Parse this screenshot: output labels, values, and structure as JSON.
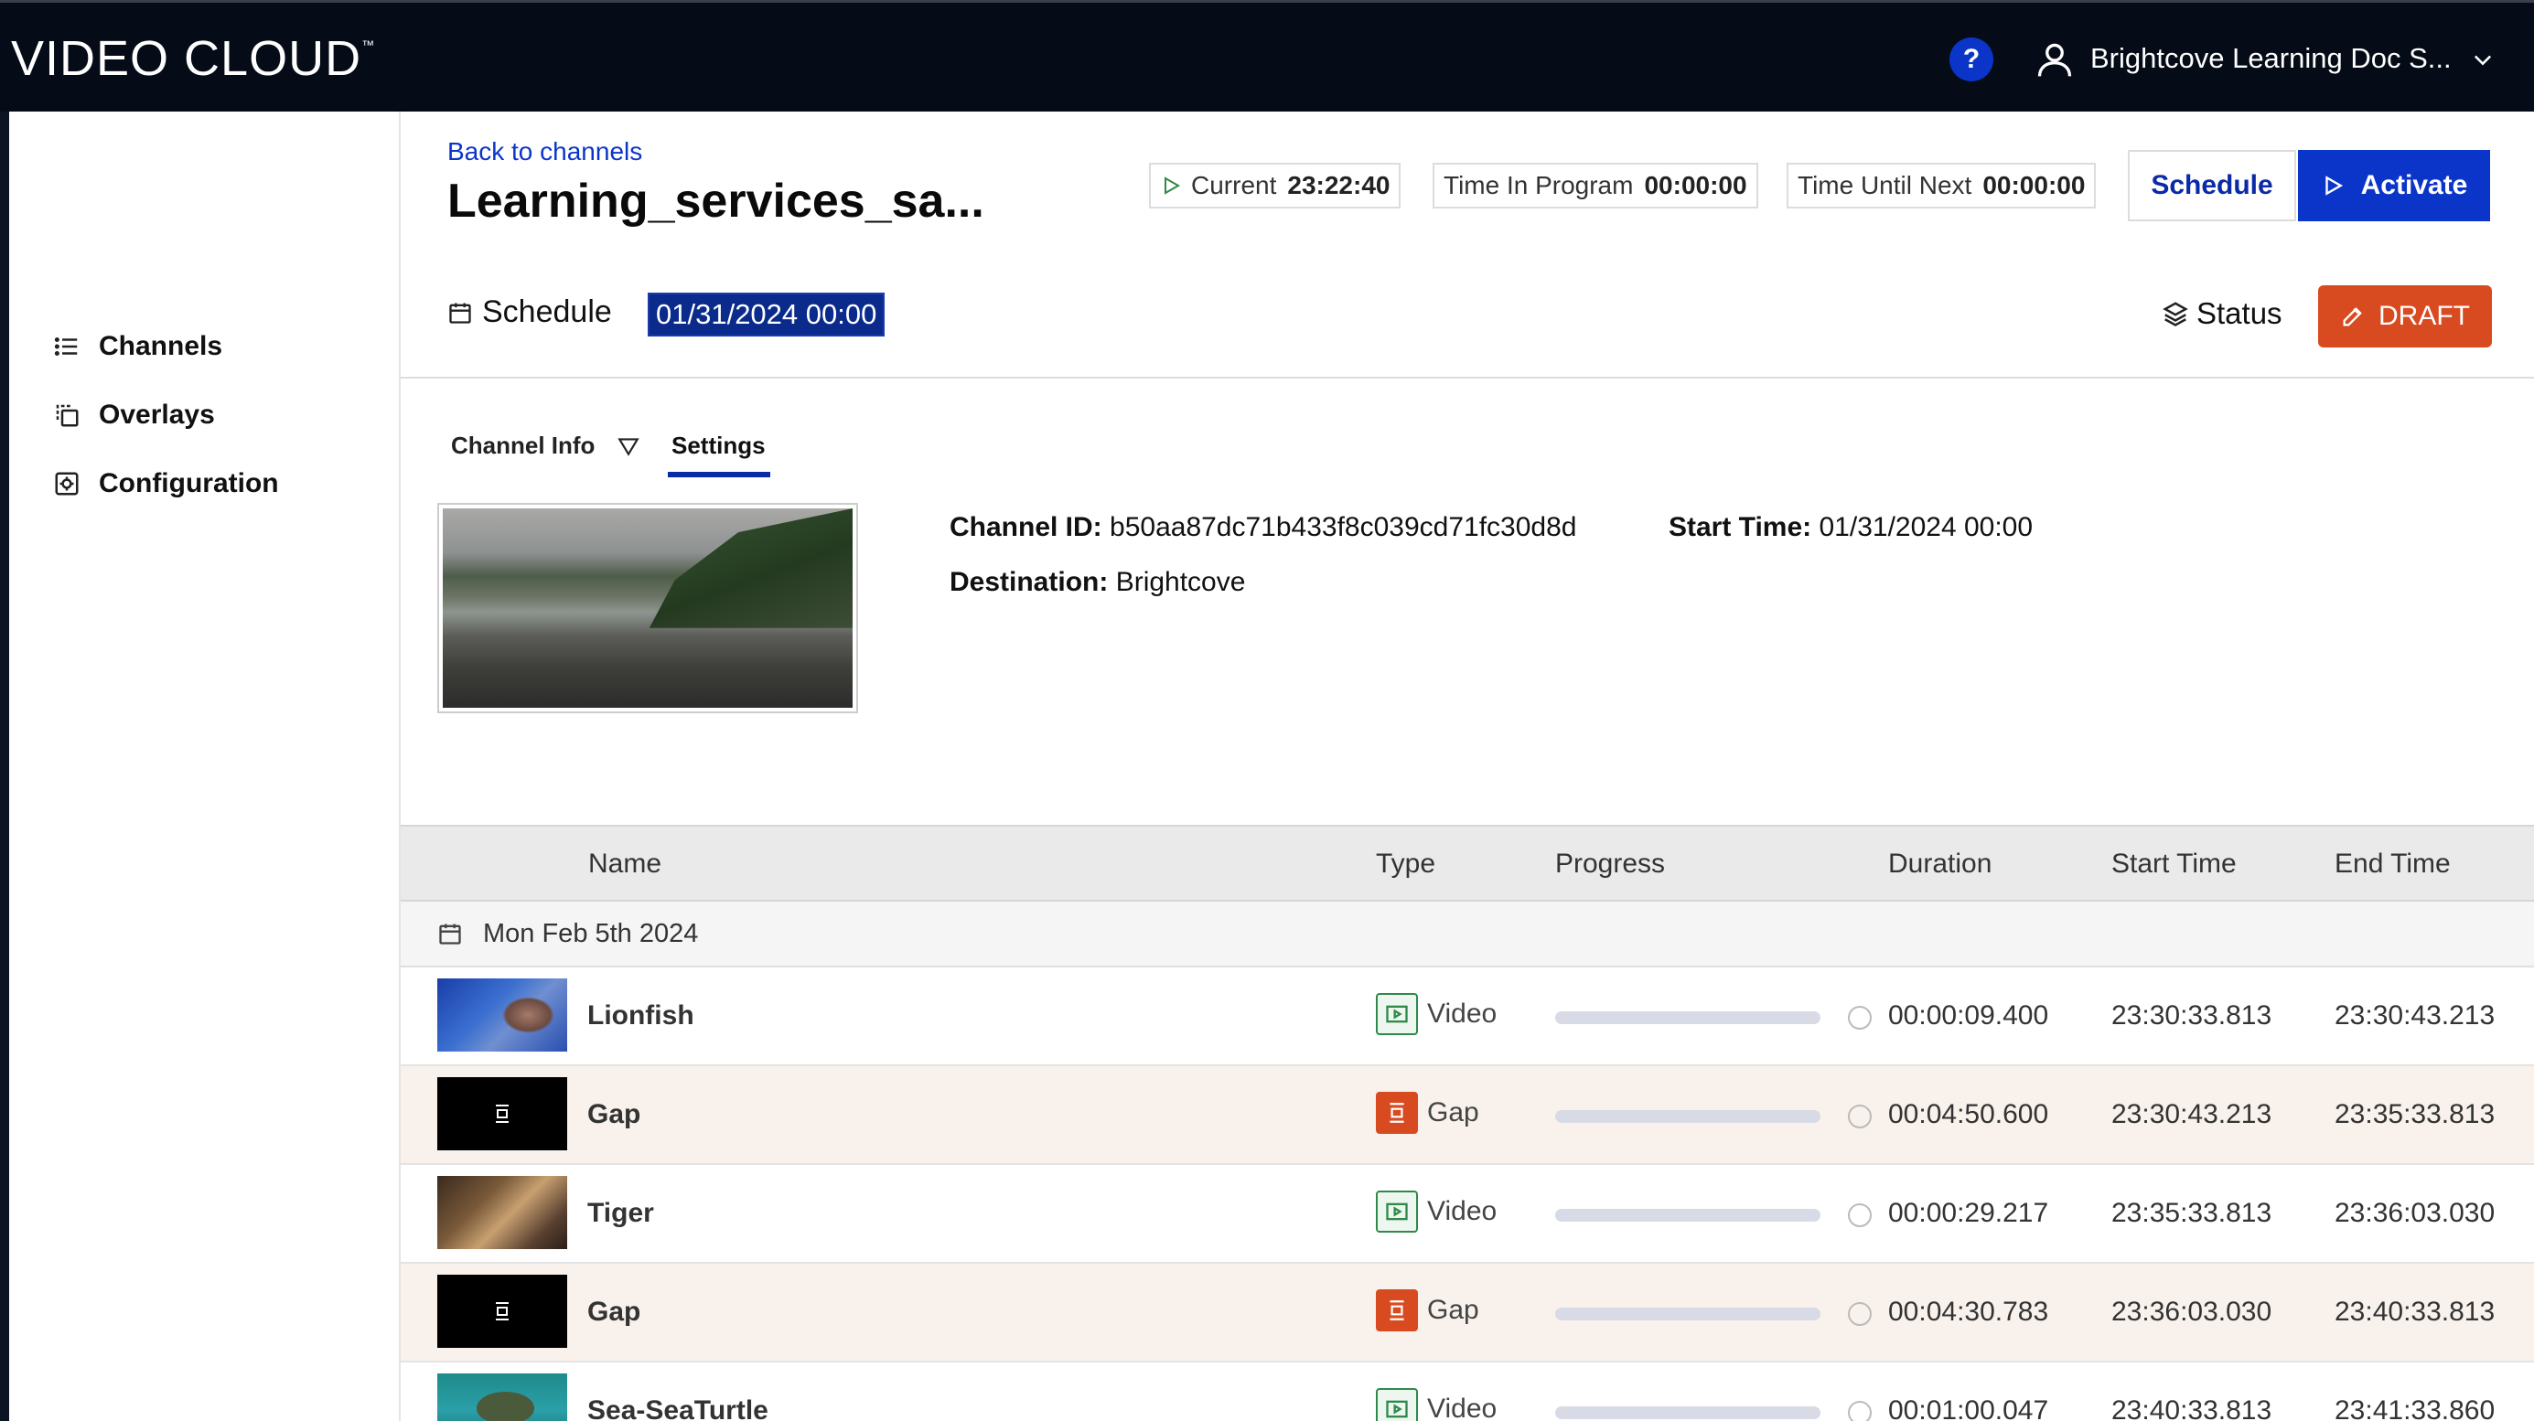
{
  "app": {
    "logo": "VIDEO CLOUD",
    "logo_tm": "™"
  },
  "header": {
    "help_label": "?",
    "account_name": "Brightcove Learning Doc S..."
  },
  "sidebar": {
    "items": [
      {
        "label": "Channels",
        "icon": "list-icon"
      },
      {
        "label": "Overlays",
        "icon": "overlays-icon"
      },
      {
        "label": "Configuration",
        "icon": "configuration-icon"
      }
    ]
  },
  "channel": {
    "back_link": "Back to channels",
    "title": "Learning_services_sa...",
    "current_label": "Current",
    "current_value": "23:22:40",
    "time_in_program_label": "Time In Program",
    "time_in_program_value": "00:00:00",
    "time_until_next_label": "Time Until Next",
    "time_until_next_value": "00:00:00",
    "schedule_button": "Schedule",
    "activate_button": "Activate",
    "schedule_label": "Schedule",
    "schedule_date": "01/31/2024 00:00",
    "status_label": "Status",
    "status_value": "DRAFT"
  },
  "tabs": {
    "channel_info": "Channel Info",
    "settings": "Settings"
  },
  "details": {
    "channel_id_label": "Channel ID:",
    "channel_id_value": "b50aa87dc71b433f8c039cd71fc30d8d",
    "start_time_label": "Start Time:",
    "start_time_value": "01/31/2024 00:00",
    "destination_label": "Destination:",
    "destination_value": "Brightcove"
  },
  "table": {
    "columns": {
      "name": "Name",
      "type": "Type",
      "progress": "Progress",
      "duration": "Duration",
      "start": "Start Time",
      "end": "End Time"
    },
    "group_date": "Mon Feb 5th 2024",
    "rows": [
      {
        "name": "Lionfish",
        "type": "Video",
        "progress": 0,
        "duration": "00:00:09.400",
        "start": "23:30:33.813",
        "end": "23:30:43.213"
      },
      {
        "name": "Gap",
        "type": "Gap",
        "progress": 0,
        "duration": "00:04:50.600",
        "start": "23:30:43.213",
        "end": "23:35:33.813"
      },
      {
        "name": "Tiger",
        "type": "Video",
        "progress": 0,
        "duration": "00:00:29.217",
        "start": "23:35:33.813",
        "end": "23:36:03.030"
      },
      {
        "name": "Gap",
        "type": "Gap",
        "progress": 0,
        "duration": "00:04:30.783",
        "start": "23:36:03.030",
        "end": "23:40:33.813"
      },
      {
        "name": "Sea-SeaTurtle",
        "type": "Video",
        "progress": 0,
        "duration": "00:01:00.047",
        "start": "23:40:33.813",
        "end": "23:41:33.860"
      }
    ]
  },
  "colors": {
    "brand_blue": "#0b35c8",
    "draft_orange": "#d84a20",
    "topbar": "#050b17",
    "video_green": "#2f8a4a"
  }
}
